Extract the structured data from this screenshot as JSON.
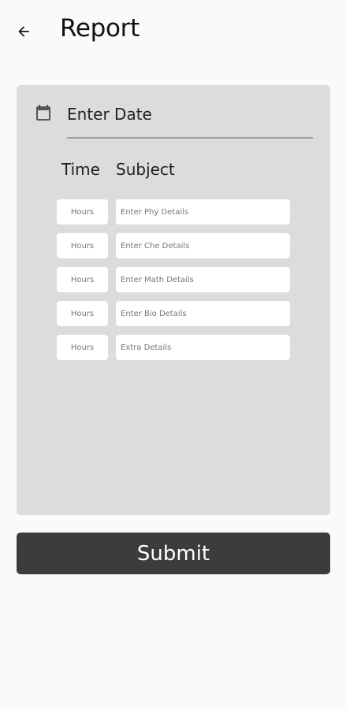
{
  "header": {
    "title": "Report",
    "back_icon": "arrow-left-icon"
  },
  "form": {
    "date_placeholder": "Enter Date",
    "calendar_icon": "calendar-icon",
    "columns": {
      "time": "Time",
      "subject": "Subject"
    },
    "rows": [
      {
        "hours_placeholder": "Hours",
        "detail_placeholder": "Enter Phy Details"
      },
      {
        "hours_placeholder": "Hours",
        "detail_placeholder": "Enter Che Details"
      },
      {
        "hours_placeholder": "Hours",
        "detail_placeholder": "Enter Math Details"
      },
      {
        "hours_placeholder": "Hours",
        "detail_placeholder": "Enter Bio Details"
      },
      {
        "hours_placeholder": "Hours",
        "detail_placeholder": "Extra Details"
      }
    ]
  },
  "submit_label": "Submit",
  "colors": {
    "background": "#fafafa",
    "card": "#dcdcdc",
    "button": "#3c3c3c"
  }
}
